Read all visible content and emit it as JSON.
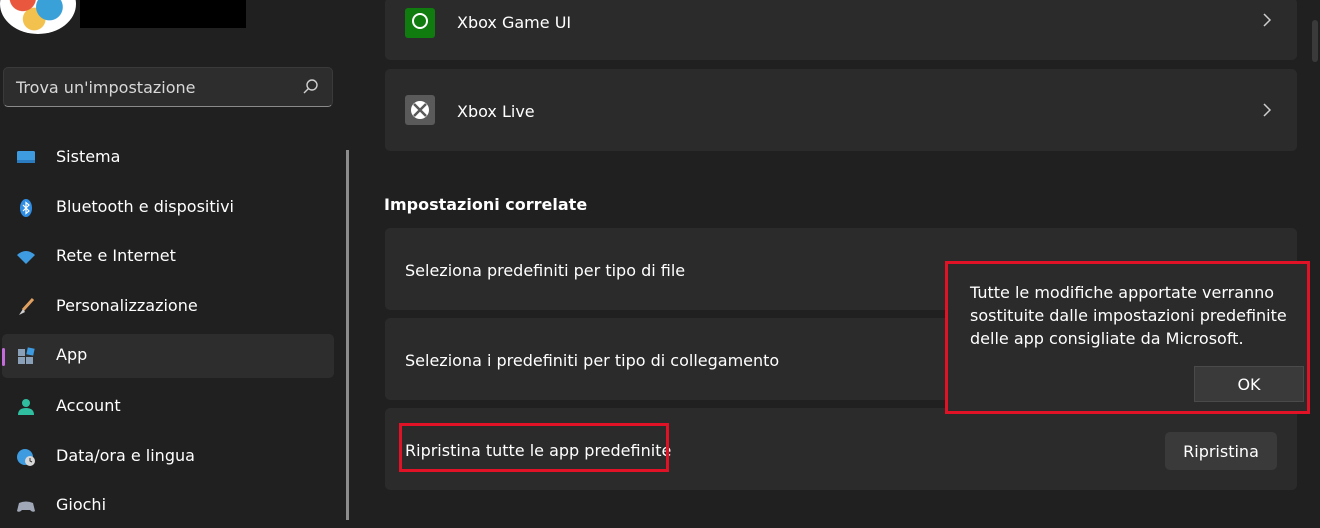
{
  "search": {
    "placeholder": "Trova un'impostazione"
  },
  "sidebar": {
    "items": [
      {
        "label": "Sistema",
        "icon": "monitor-icon"
      },
      {
        "label": "Bluetooth e dispositivi",
        "icon": "bluetooth-icon"
      },
      {
        "label": "Rete e Internet",
        "icon": "wifi-icon"
      },
      {
        "label": "Personalizzazione",
        "icon": "brush-icon"
      },
      {
        "label": "App",
        "icon": "apps-icon",
        "selected": true
      },
      {
        "label": "Account",
        "icon": "person-icon"
      },
      {
        "label": "Data/ora e lingua",
        "icon": "globe-clock-icon"
      },
      {
        "label": "Giochi",
        "icon": "gamepad-icon"
      }
    ]
  },
  "main": {
    "apps": [
      {
        "label": "Xbox Game UI",
        "icon": "xbox-game-ui-icon"
      },
      {
        "label": "Xbox Live",
        "icon": "xbox-live-icon"
      }
    ],
    "related_heading": "Impostazioni correlate",
    "related": [
      {
        "label": "Seleziona predefiniti per tipo di file"
      },
      {
        "label": "Seleziona i predefiniti per tipo di collegamento"
      }
    ],
    "reset": {
      "label": "Ripristina tutte le app predefinite",
      "button": "Ripristina"
    }
  },
  "popup": {
    "message": "Tutte le modifiche apportate verranno sostituite dalle impostazioni predefinite delle app consigliate da Microsoft.",
    "ok": "OK"
  },
  "colors": {
    "accent": "#c36bd9",
    "highlight": "#e11226",
    "background": "#202020",
    "card": "#2b2b2b"
  }
}
